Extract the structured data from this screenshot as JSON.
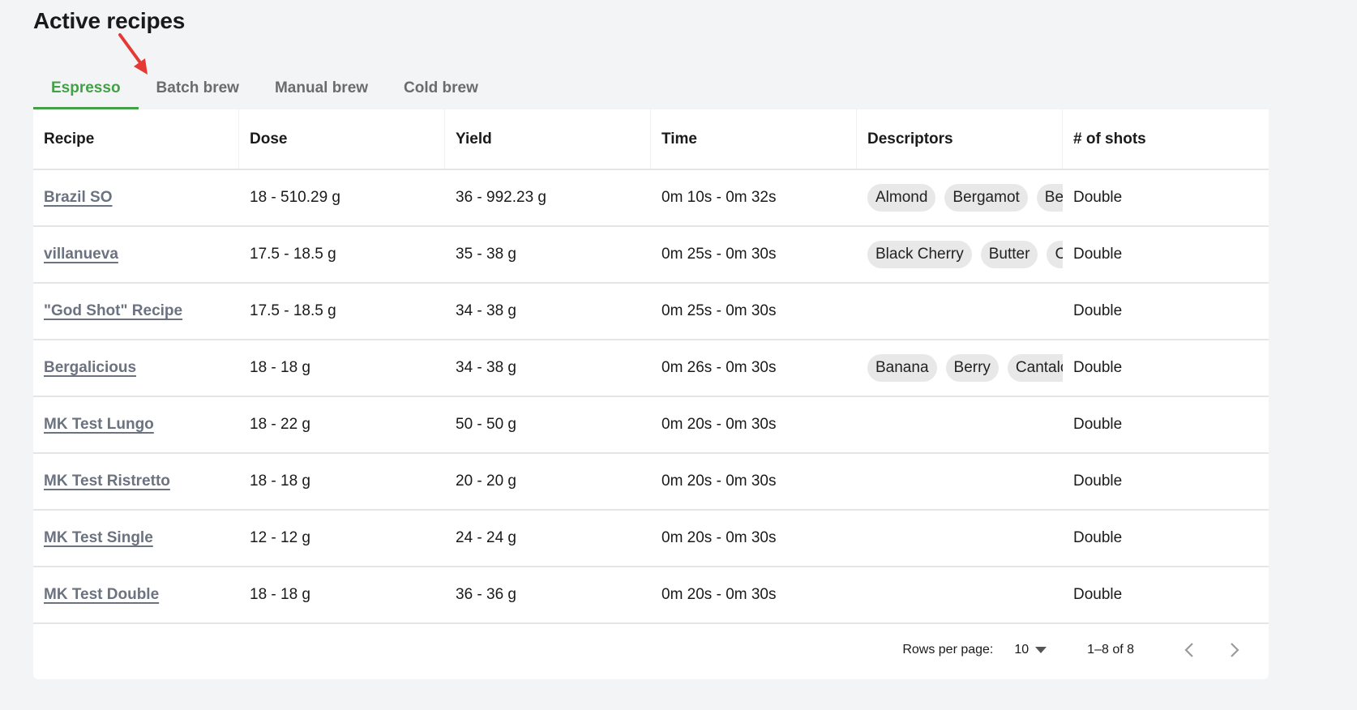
{
  "page": {
    "title": "Active recipes"
  },
  "tabs": [
    {
      "label": "Espresso",
      "active": true
    },
    {
      "label": "Batch brew",
      "active": false
    },
    {
      "label": "Manual brew",
      "active": false
    },
    {
      "label": "Cold brew",
      "active": false
    }
  ],
  "colors": {
    "accent": "#43a047",
    "annotation_arrow": "#e53935",
    "link": "#6b7280"
  },
  "table": {
    "columns": [
      "Recipe",
      "Dose",
      "Yield",
      "Time",
      "Descriptors",
      "# of shots"
    ],
    "rows": [
      {
        "recipe": "Brazil SO",
        "dose": "18 - 510.29 g",
        "yield": "36 - 992.23 g",
        "time": "0m 10s - 0m 32s",
        "descriptors": [
          "Almond",
          "Bergamot",
          "Berry"
        ],
        "shots": "Double"
      },
      {
        "recipe": "villanueva",
        "dose": "17.5 - 18.5 g",
        "yield": "35 - 38 g",
        "time": "0m 25s - 0m 30s",
        "descriptors": [
          "Black Cherry",
          "Butter",
          "Caramel"
        ],
        "shots": "Double"
      },
      {
        "recipe": "\"God Shot\" Recipe",
        "dose": "17.5 - 18.5 g",
        "yield": "34 - 38 g",
        "time": "0m 25s - 0m 30s",
        "descriptors": [],
        "shots": "Double"
      },
      {
        "recipe": "Bergalicious",
        "dose": "18 - 18 g",
        "yield": "34 - 38 g",
        "time": "0m 26s - 0m 30s",
        "descriptors": [
          "Banana",
          "Berry",
          "Cantaloupe"
        ],
        "shots": "Double"
      },
      {
        "recipe": "MK Test Lungo",
        "dose": "18 - 22 g",
        "yield": "50 - 50 g",
        "time": "0m 20s - 0m 30s",
        "descriptors": [],
        "shots": "Double"
      },
      {
        "recipe": "MK Test Ristretto",
        "dose": "18 - 18 g",
        "yield": "20 - 20 g",
        "time": "0m 20s - 0m 30s",
        "descriptors": [],
        "shots": "Double"
      },
      {
        "recipe": "MK Test Single",
        "dose": "12 - 12 g",
        "yield": "24 - 24 g",
        "time": "0m 20s - 0m 30s",
        "descriptors": [],
        "shots": "Double"
      },
      {
        "recipe": "MK Test Double",
        "dose": "18 - 18 g",
        "yield": "36 - 36 g",
        "time": "0m 20s - 0m 30s",
        "descriptors": [],
        "shots": "Double"
      }
    ]
  },
  "pagination": {
    "rows_per_page_label": "Rows per page:",
    "rows_per_page_value": "10",
    "range": "1–8 of 8",
    "prev_icon": "chevron-left-icon",
    "next_icon": "chevron-right-icon"
  }
}
